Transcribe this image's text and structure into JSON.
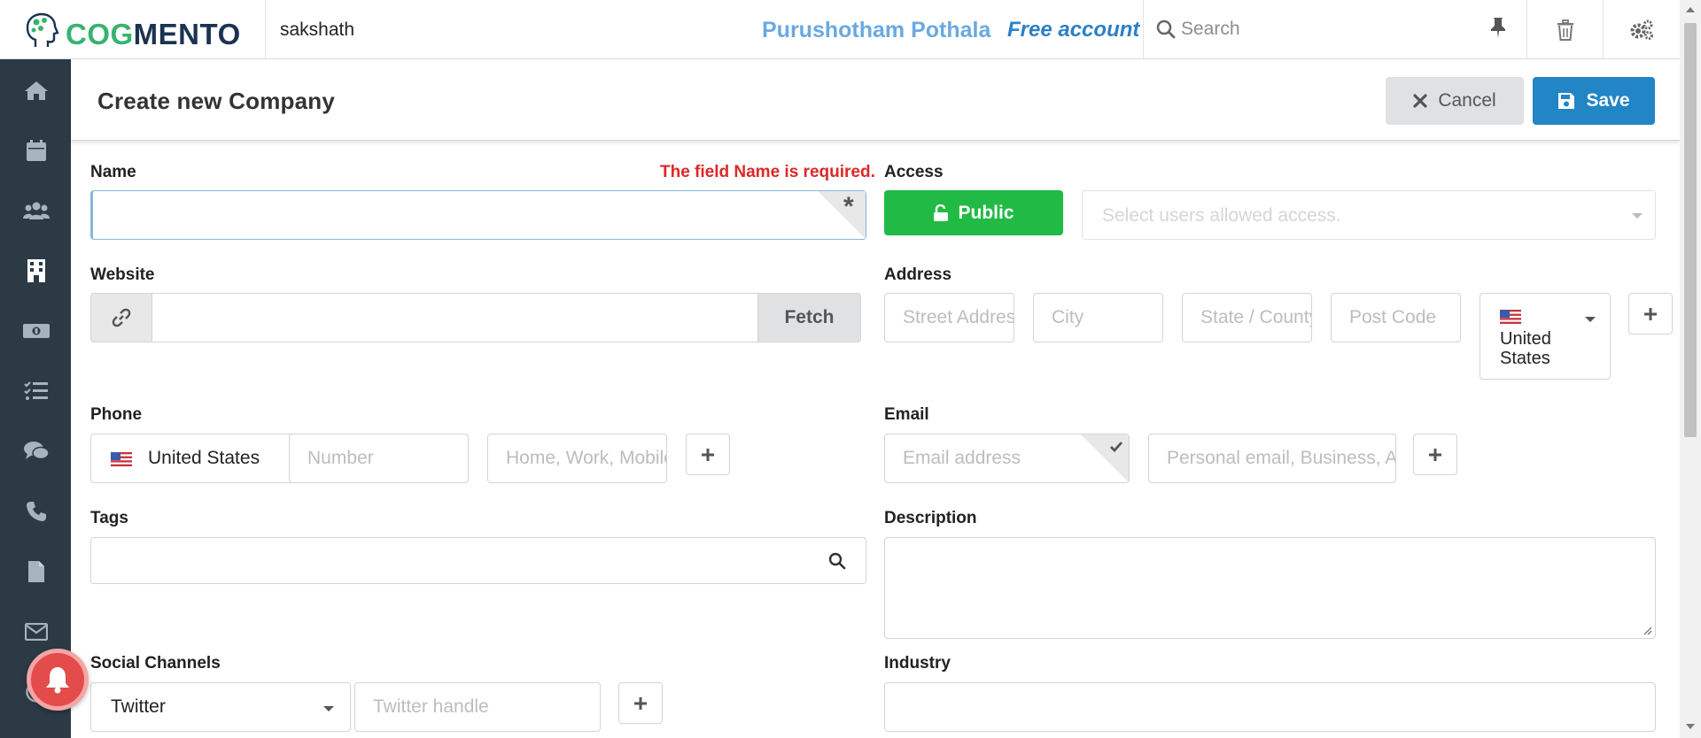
{
  "app": {
    "brand_part1": "COG",
    "brand_part2": "MENTO",
    "workspace": "sakshath",
    "user_name": "Purushotham Pothala",
    "account_type": "Free account",
    "search_placeholder": "Search",
    "colors": {
      "brand_green": "#38b36f",
      "brand_navy": "#1b3350",
      "sidebar": "#2b3a45",
      "primary": "#2185c6",
      "success": "#21ba45",
      "error": "#db2828"
    }
  },
  "sidebar": {
    "items": [
      {
        "icon": "home-icon"
      },
      {
        "icon": "calendar-icon"
      },
      {
        "icon": "contacts-icon"
      },
      {
        "icon": "companies-icon"
      },
      {
        "icon": "deals-icon"
      },
      {
        "icon": "tasks-icon"
      },
      {
        "icon": "cases-icon"
      },
      {
        "icon": "calls-icon"
      },
      {
        "icon": "documents-icon"
      },
      {
        "icon": "email-icon"
      }
    ]
  },
  "header": {
    "title": "Create new Company",
    "cancel_label": "Cancel",
    "save_label": "Save"
  },
  "form": {
    "name": {
      "label": "Name",
      "error": "The field Name is required.",
      "value": "",
      "required_mark": "*"
    },
    "access": {
      "label": "Access",
      "public_label": "Public",
      "users_placeholder": "Select users allowed access."
    },
    "website": {
      "label": "Website",
      "fetch_label": "Fetch",
      "value": ""
    },
    "address": {
      "label": "Address",
      "street_placeholder": "Street Address",
      "city_placeholder": "City",
      "state_placeholder": "State / County",
      "postcode_placeholder": "Post Code",
      "country": "United States"
    },
    "phone": {
      "label": "Phone",
      "country": "United States",
      "number_placeholder": "Number",
      "type_placeholder": "Home, Work, Mobile..."
    },
    "email": {
      "label": "Email",
      "address_placeholder": "Email address",
      "type_placeholder": "Personal email, Business, Alt..."
    },
    "tags": {
      "label": "Tags"
    },
    "description": {
      "label": "Description"
    },
    "social": {
      "label": "Social Channels",
      "channel": "Twitter",
      "handle_placeholder": "Twitter handle"
    },
    "industry": {
      "label": "Industry"
    }
  }
}
